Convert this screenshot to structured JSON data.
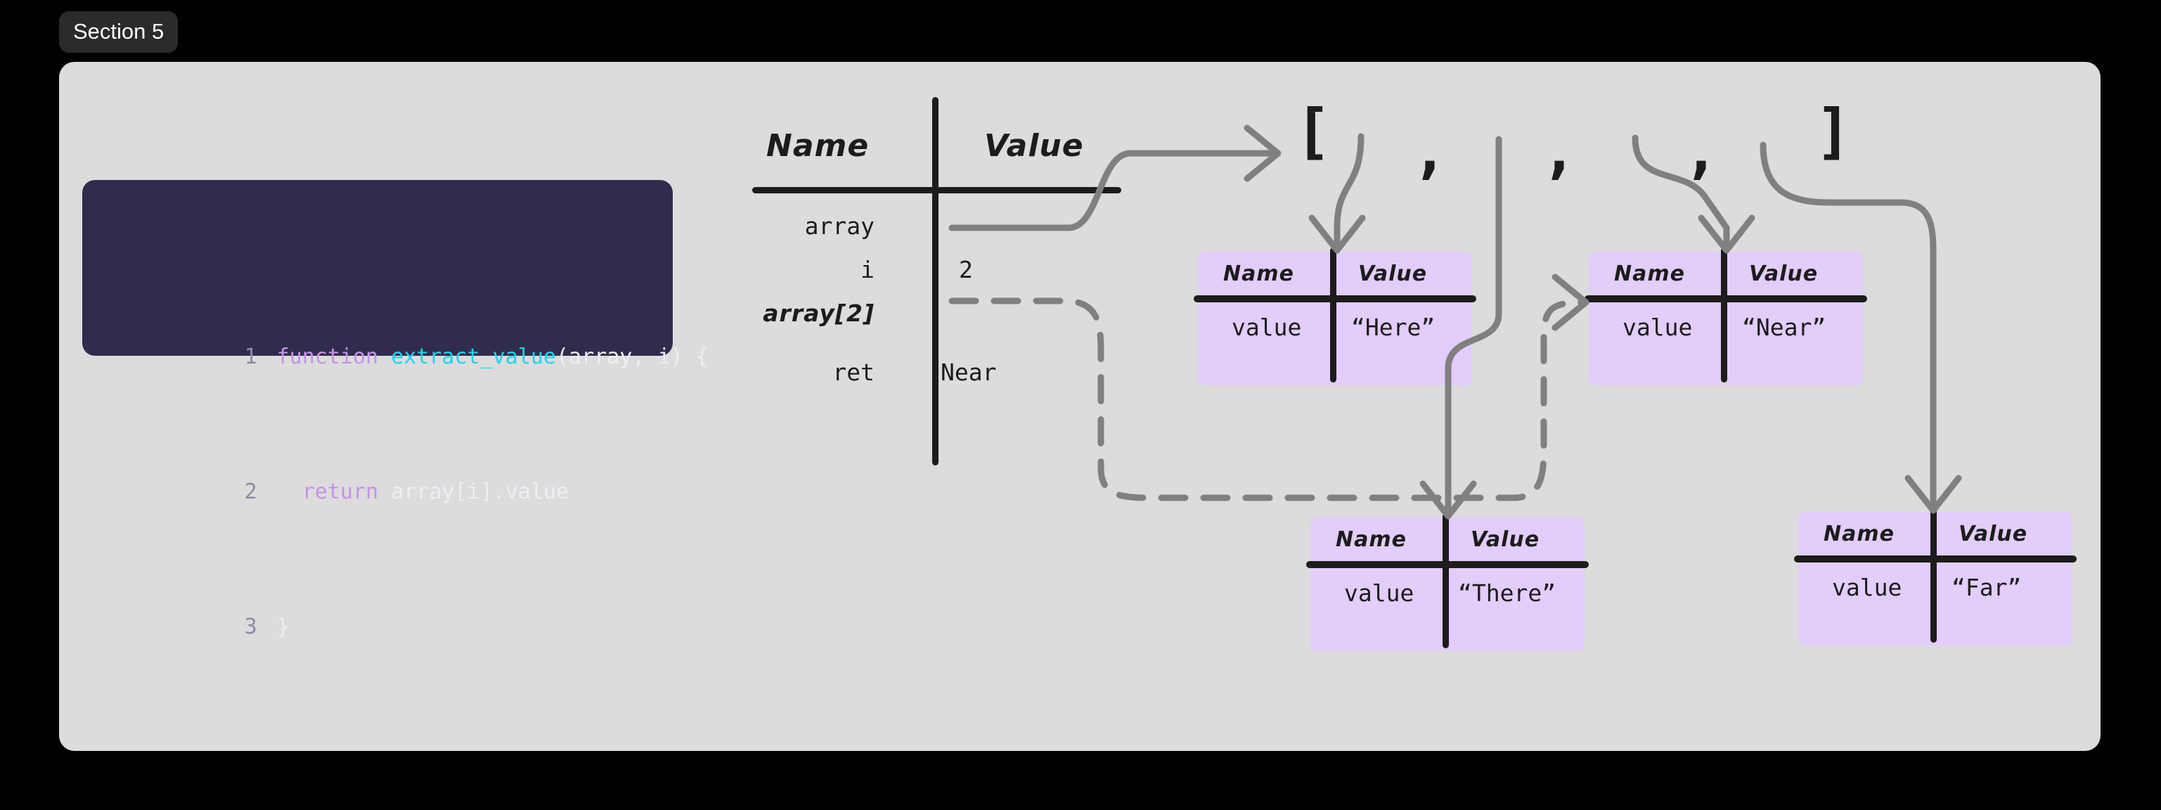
{
  "section": {
    "label": "Section 5"
  },
  "code": {
    "language": "javascript",
    "lines": [
      {
        "number": "1",
        "tokens": [
          {
            "text": "function ",
            "kind": "keyword"
          },
          {
            "text": "extract_value",
            "kind": "function"
          },
          {
            "text": "(array, i) {",
            "kind": "plain"
          }
        ]
      },
      {
        "number": "2",
        "tokens": [
          {
            "text": "  ",
            "kind": "plain"
          },
          {
            "text": "return ",
            "kind": "keyword"
          },
          {
            "text": "array[i].value",
            "kind": "plain"
          }
        ]
      },
      {
        "number": "3",
        "tokens": [
          {
            "text": "}",
            "kind": "plain"
          }
        ]
      }
    ]
  },
  "env_table": {
    "headers": {
      "name": "Name",
      "value": "Value"
    },
    "rows": [
      {
        "name": "array",
        "value": "",
        "value_kind": "pointer-solid"
      },
      {
        "name": "i",
        "value": "2",
        "value_kind": "number"
      },
      {
        "name": "array[2]",
        "value": "",
        "value_kind": "pointer-dashed"
      },
      {
        "name": "ret",
        "value": "Near",
        "value_kind": "text"
      }
    ]
  },
  "array_literal": {
    "open_bracket": "[",
    "close_bracket": "]",
    "separators": [
      ",",
      ",",
      ","
    ],
    "slot_count": 4
  },
  "objects": [
    {
      "id": "here",
      "headers": {
        "name": "Name",
        "value": "Value"
      },
      "cells": {
        "name": "value",
        "value": "“Here”"
      }
    },
    {
      "id": "near",
      "headers": {
        "name": "Name",
        "value": "Value"
      },
      "cells": {
        "name": "value",
        "value": "“Near”"
      }
    },
    {
      "id": "there",
      "headers": {
        "name": "Name",
        "value": "Value"
      },
      "cells": {
        "name": "value",
        "value": "“There”"
      }
    },
    {
      "id": "far",
      "headers": {
        "name": "Name",
        "value": "Value"
      },
      "cells": {
        "name": "value",
        "value": "“Far”"
      }
    }
  ],
  "colors": {
    "page_background": "#000000",
    "panel_background": "#dcdcdc",
    "badge_background": "#2b2b2b",
    "badge_text": "#ffffff",
    "code_background": "#312c4d",
    "code_linenumber": "#8d8aa3",
    "code_keyword": "#c792ea",
    "code_function": "#22d3ee",
    "code_plain": "#eceff4",
    "object_box": "#e2cdfb",
    "rule": "#1c1c1c",
    "connector": "#808080"
  }
}
